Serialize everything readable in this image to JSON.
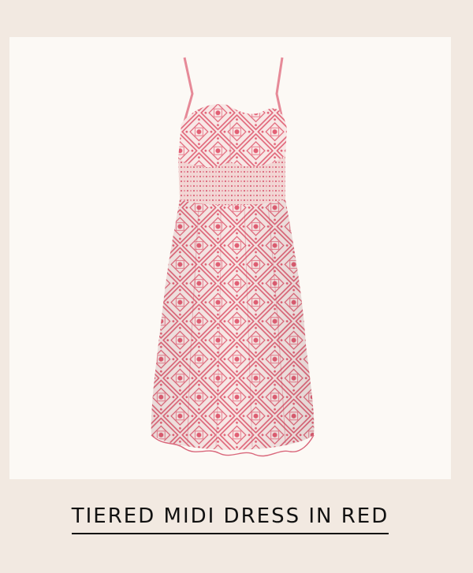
{
  "product": {
    "title": "TIERED MIDI DRESS IN RED",
    "image_subject": "pink-red patterned sleeveless midi dress with smocked waist",
    "colors": {
      "page_background": "#f2e9e1",
      "card_background": "#fcf9f5",
      "fabric_base": "#f7e6e3",
      "fabric_print": "#e05a6e",
      "title_text": "#111111"
    }
  }
}
